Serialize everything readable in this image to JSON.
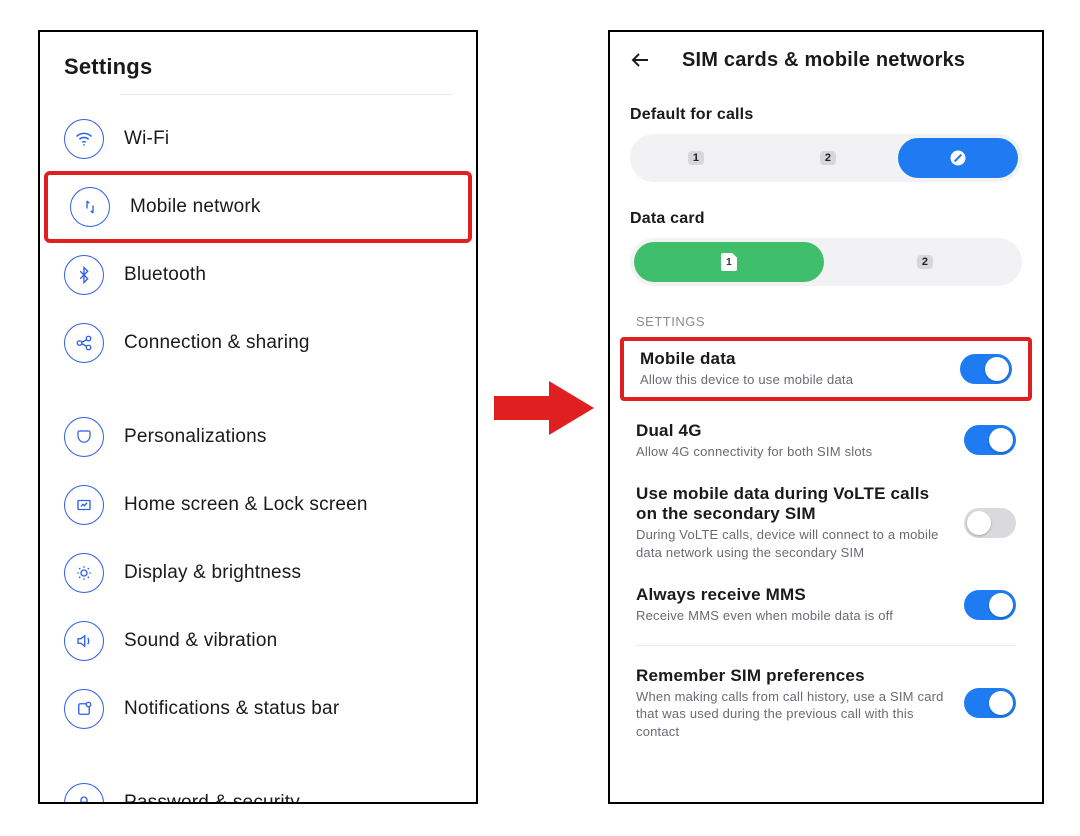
{
  "left": {
    "header": "Settings",
    "items": [
      {
        "label": "Wi-Fi"
      },
      {
        "label": "Mobile network"
      },
      {
        "label": "Bluetooth"
      },
      {
        "label": "Connection & sharing"
      },
      {
        "label": "Personalizations"
      },
      {
        "label": "Home screen & Lock screen"
      },
      {
        "label": "Display & brightness"
      },
      {
        "label": "Sound & vibration"
      },
      {
        "label": "Notifications & status bar"
      },
      {
        "label": "Password & security"
      }
    ]
  },
  "right": {
    "title": "SIM cards & mobile networks",
    "default_calls_label": "Default for calls",
    "calls": {
      "opt1": "1",
      "opt2": "2"
    },
    "data_card_label": "Data card",
    "data": {
      "opt1": "1",
      "opt2": "2"
    },
    "settings_header": "SETTINGS",
    "rows": [
      {
        "title": "Mobile data",
        "sub": "Allow this device to use mobile data"
      },
      {
        "title": "Dual 4G",
        "sub": "Allow 4G connectivity for both SIM slots"
      },
      {
        "title": "Use mobile data during VoLTE calls on the secondary SIM",
        "sub": "During VoLTE calls, device will connect to a mobile data network using the secondary SIM"
      },
      {
        "title": "Always receive MMS",
        "sub": "Receive MMS even when mobile data is off"
      },
      {
        "title": "Remember SIM preferences",
        "sub": "When making calls from call history, use a SIM card that was used during the previous call with this contact"
      }
    ]
  }
}
